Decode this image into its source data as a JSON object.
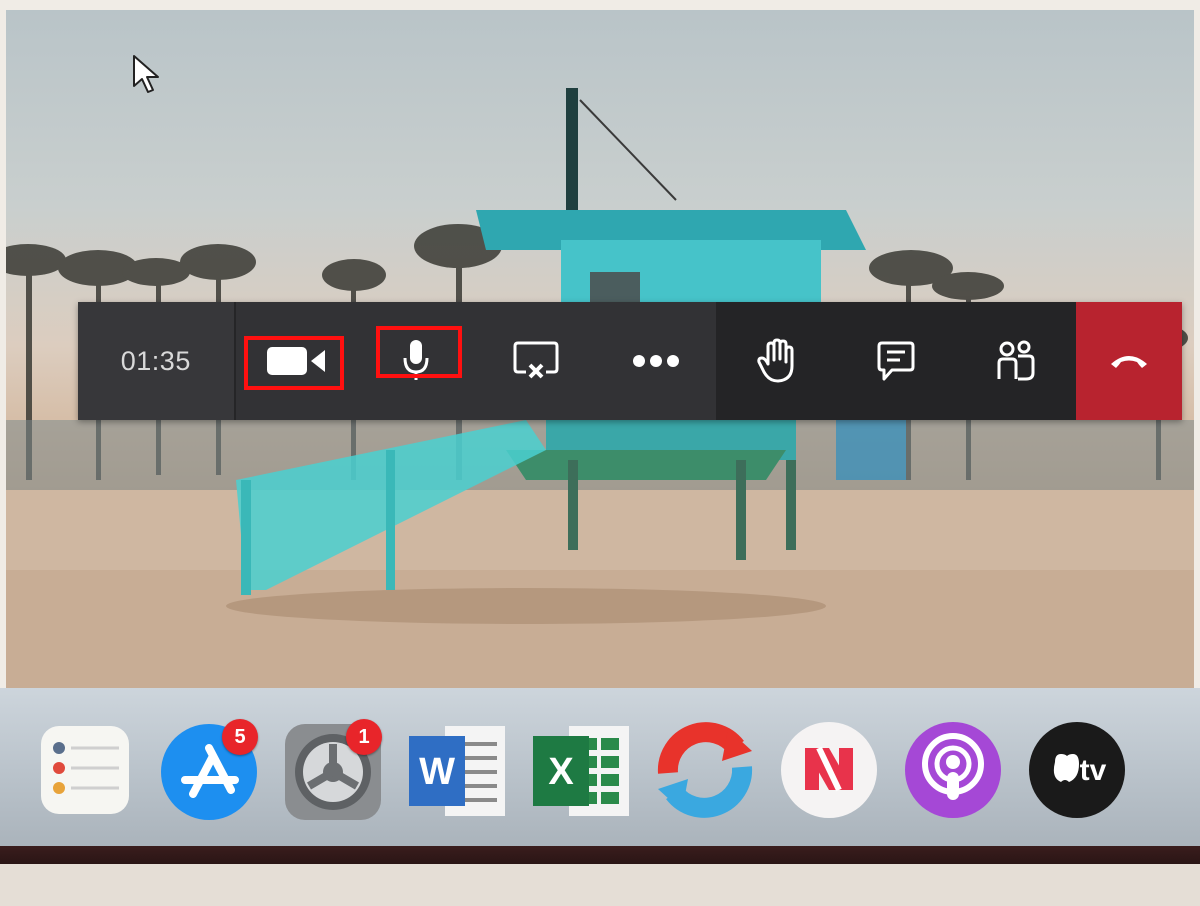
{
  "meeting_controls": {
    "timer": "01:35",
    "camera": {
      "icon": "video-camera-icon",
      "highlighted": true
    },
    "microphone": {
      "icon": "microphone-icon",
      "highlighted": true
    },
    "share": {
      "icon": "stop-share-icon"
    },
    "more": {
      "icon": "more-options-icon"
    },
    "raise_hand": {
      "icon": "raise-hand-icon"
    },
    "chat": {
      "icon": "chat-icon"
    },
    "participants": {
      "icon": "participants-icon"
    },
    "hang_up": {
      "icon": "hang-up-icon",
      "color": "#b8232f"
    },
    "highlight_color": "#ff1010"
  },
  "dock": {
    "items": [
      {
        "name": "reminders",
        "icon": "reminders-icon"
      },
      {
        "name": "app-store",
        "icon": "app-store-icon",
        "badge": "5"
      },
      {
        "name": "system-preferences",
        "icon": "gear-icon",
        "badge": "1"
      },
      {
        "name": "word",
        "icon": "word-icon",
        "letter": "W"
      },
      {
        "name": "excel",
        "icon": "excel-icon",
        "letter": "X"
      },
      {
        "name": "sync-app",
        "icon": "sync-icon"
      },
      {
        "name": "news",
        "icon": "news-icon"
      },
      {
        "name": "podcasts",
        "icon": "podcasts-icon"
      },
      {
        "name": "apple-tv",
        "icon": "apple-tv-icon",
        "label": "tv"
      }
    ]
  }
}
